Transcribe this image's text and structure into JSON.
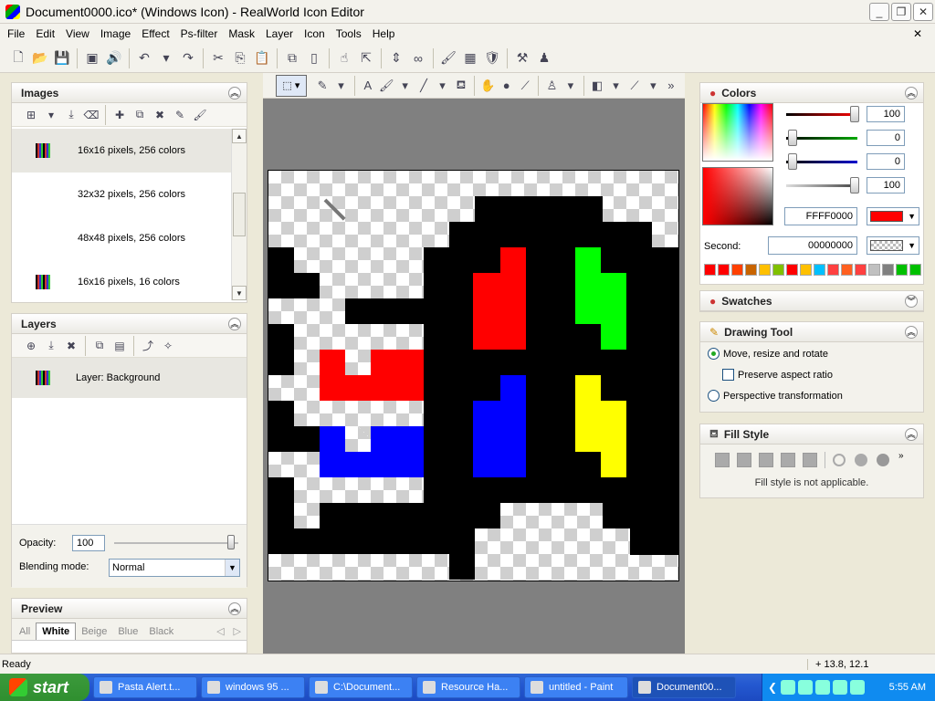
{
  "window": {
    "title": "Document0000.ico* (Windows Icon) - RealWorld Icon Editor",
    "minimize": "_",
    "maximize": "❐",
    "close": "✕"
  },
  "menu": [
    "File",
    "Edit",
    "View",
    "Image",
    "Effect",
    "Ps-filter",
    "Mask",
    "Layer",
    "Icon",
    "Tools",
    "Help"
  ],
  "menu_close": "✕",
  "images_panel": {
    "title": "Images",
    "items": [
      {
        "label": "16x16 pixels, 256 colors",
        "selected": true,
        "has_icon": true
      },
      {
        "label": "32x32 pixels, 256 colors",
        "selected": false,
        "has_icon": false
      },
      {
        "label": "48x48 pixels, 256 colors",
        "selected": false,
        "has_icon": false
      },
      {
        "label": "16x16 pixels, 16 colors",
        "selected": false,
        "has_icon": true
      }
    ]
  },
  "layers_panel": {
    "title": "Layers",
    "layer": "Layer: Background",
    "opacity_label": "Opacity:",
    "opacity_value": "100",
    "blending_label": "Blending mode:",
    "blending_value": "Normal"
  },
  "preview_panel": {
    "title": "Preview",
    "tabs": [
      "All",
      "White",
      "Beige",
      "Blue",
      "Black"
    ],
    "active_tab": "White"
  },
  "colors_panel": {
    "title": "Colors",
    "sliders": [
      {
        "value": "100",
        "color": "#ff0000"
      },
      {
        "value": "0",
        "color": "#00a000"
      },
      {
        "value": "0",
        "color": "#0000c0"
      },
      {
        "value": "100",
        "color": "#888888"
      }
    ],
    "primary_hex": "FFFF0000",
    "primary_color": "#ff0000",
    "second_label": "Second:",
    "second_hex": "00000000",
    "palette": [
      "#ff0000",
      "#ff0000",
      "#ff4000",
      "#c86400",
      "#ffc000",
      "#80c000",
      "#ff0000",
      "#ffc000",
      "#00c0ff",
      "#ff4040",
      "#ff6020",
      "#ff4040",
      "#c0c0c0",
      "#808080",
      "#00c000",
      "#00c000"
    ]
  },
  "swatches_panel": {
    "title": "Swatches"
  },
  "drawing_tool_panel": {
    "title": "Drawing Tool",
    "option_move": "Move, resize and rotate",
    "option_aspect": "Preserve aspect ratio",
    "option_perspective": "Perspective transformation"
  },
  "fill_style_panel": {
    "title": "Fill Style",
    "note": "Fill style is not applicable."
  },
  "status": {
    "text": "Ready",
    "coords": "13.8, 12.1"
  },
  "taskbar": {
    "start": "start",
    "tasks": [
      "Pasta Alert.t...",
      "windows 95 ...",
      "C:\\Document...",
      "Resource Ha...",
      "untitled - Paint",
      "Document00..."
    ],
    "active_index": 5,
    "clock": "5:55 AM"
  },
  "colors": {
    "accent": "#316ac5",
    "taskbar": "#2458d0"
  }
}
